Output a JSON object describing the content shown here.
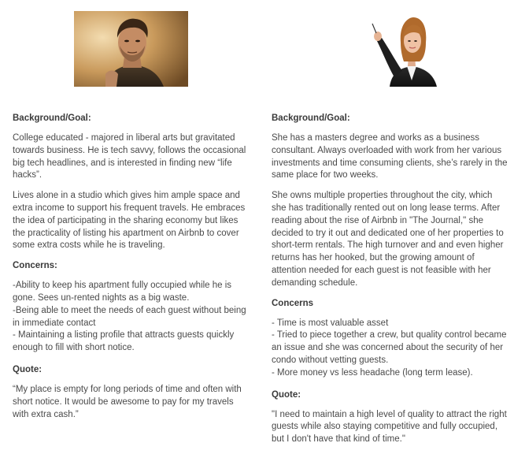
{
  "left": {
    "photo_icon": "man-portrait-photo",
    "background_heading": "Background/Goal:",
    "background_p1": "College educated - majored in liberal arts but gravitated towards business. He is tech savvy, follows the occasional big tech headlines, and is interested in finding new “life hacks”.",
    "background_p2": "Lives alone in a studio which gives him ample space and extra income to support his frequent travels. He embraces the idea of participating in the sharing economy but likes the practicality of listing his apartment on Airbnb to cover some extra costs while he is traveling.",
    "concerns_heading": "Concerns:",
    "concerns": [
      "-Ability to keep his apartment fully occupied while he is gone. Sees un-rented nights as a big waste.",
      "-Being able to meet the needs of each guest without being in immediate contact",
      "- Maintaining a listing profile that attracts guests quickly enough to fill with short notice."
    ],
    "quote_heading": "Quote:",
    "quote": "“My place is empty for long periods of time and often with short notice. It would be awesome to pay for my travels with extra cash.”"
  },
  "right": {
    "photo_icon": "businesswoman-portrait-photo",
    "background_heading": "Background/Goal:",
    "background_p1": "She has a masters degree and works as a business consultant. Always overloaded with work from her various investments and time consuming clients, she’s rarely in the same place for two weeks.",
    "background_p2": "She owns multiple properties throughout the city, which she has traditionally rented out on long lease terms. After reading about the rise of Airbnb in \"The Journal,\" she decided to try it out and dedicated one of her properties to short-term rentals. The high turnover and and even higher returns has her hooked, but the growing amount of attention needed for each guest is not feasible with her demanding schedule.",
    "concerns_heading": "Concerns",
    "concerns": [
      "- Time is most valuable asset",
      "- Tried to piece together a crew, but quality control became an issue and she was concerned about the security of her condo without vetting guests.",
      "- More money vs less headache (long term lease)."
    ],
    "quote_heading": "Quote:",
    "quote": "\"I need to maintain a high level of quality to attract the right guests while also staying competitive and fully occupied, but I don't have that kind of time.\""
  }
}
